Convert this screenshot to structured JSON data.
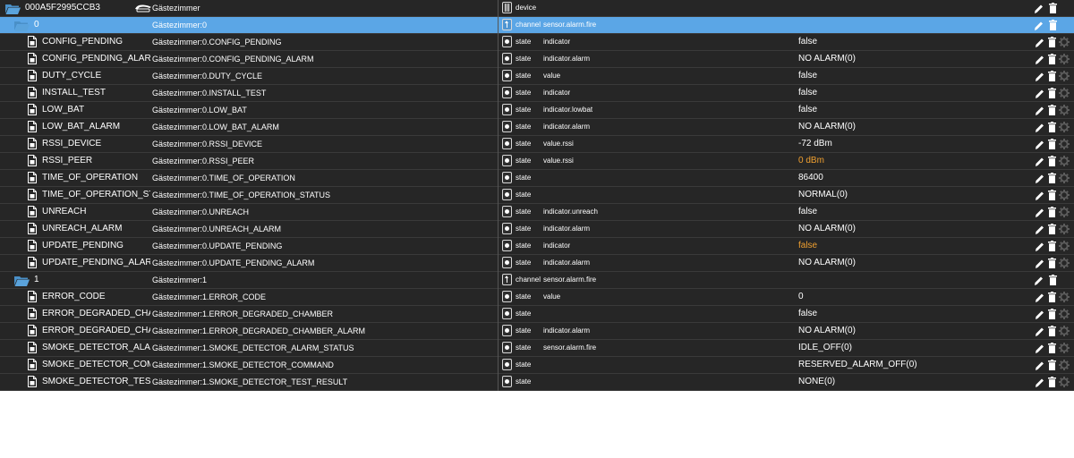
{
  "colors": {
    "row_bg": "#262626",
    "selected_bg": "#5ba6e6",
    "folder": "#4a90c8",
    "text": "#ffffff",
    "warning_value": "#f0a030",
    "icon_muted": "#555555"
  },
  "rows": [
    {
      "kind": "device",
      "level": 0,
      "name": "000A5F2995CCB3",
      "fullname": "Gästezimmer",
      "type": "device",
      "role": "",
      "value": "",
      "room_icon": true
    },
    {
      "kind": "channel",
      "level": 1,
      "name": "0",
      "fullname": "Gästezimmer:0",
      "type": "channel",
      "role": "sensor.alarm.fire",
      "value": "",
      "selected": true
    },
    {
      "kind": "state",
      "level": 2,
      "name": "CONFIG_PENDING",
      "fullname": "Gästezimmer:0.CONFIG_PENDING",
      "type": "state",
      "role": "indicator",
      "value": "false"
    },
    {
      "kind": "state",
      "level": 2,
      "name": "CONFIG_PENDING_ALARM",
      "fullname": "Gästezimmer:0.CONFIG_PENDING_ALARM",
      "type": "state",
      "role": "indicator.alarm",
      "value": "NO ALARM(0)"
    },
    {
      "kind": "state",
      "level": 2,
      "name": "DUTY_CYCLE",
      "fullname": "Gästezimmer:0.DUTY_CYCLE",
      "type": "state",
      "role": "value",
      "value": "false"
    },
    {
      "kind": "state",
      "level": 2,
      "name": "INSTALL_TEST",
      "fullname": "Gästezimmer:0.INSTALL_TEST",
      "type": "state",
      "role": "indicator",
      "value": "false"
    },
    {
      "kind": "state",
      "level": 2,
      "name": "LOW_BAT",
      "fullname": "Gästezimmer:0.LOW_BAT",
      "type": "state",
      "role": "indicator.lowbat",
      "value": "false"
    },
    {
      "kind": "state",
      "level": 2,
      "name": "LOW_BAT_ALARM",
      "fullname": "Gästezimmer:0.LOW_BAT_ALARM",
      "type": "state",
      "role": "indicator.alarm",
      "value": "NO ALARM(0)"
    },
    {
      "kind": "state",
      "level": 2,
      "name": "RSSI_DEVICE",
      "fullname": "Gästezimmer:0.RSSI_DEVICE",
      "type": "state",
      "role": "value.rssi",
      "value": "-72 dBm"
    },
    {
      "kind": "state",
      "level": 2,
      "name": "RSSI_PEER",
      "fullname": "Gästezimmer:0.RSSI_PEER",
      "type": "state",
      "role": "value.rssi",
      "value": "0 dBm",
      "value_warn": true
    },
    {
      "kind": "state",
      "level": 2,
      "name": "TIME_OF_OPERATION",
      "fullname": "Gästezimmer:0.TIME_OF_OPERATION",
      "type": "state",
      "role": "",
      "value": "86400"
    },
    {
      "kind": "state",
      "level": 2,
      "name": "TIME_OF_OPERATION_STATU",
      "fullname": "Gästezimmer:0.TIME_OF_OPERATION_STATUS",
      "type": "state",
      "role": "",
      "value": "NORMAL(0)"
    },
    {
      "kind": "state",
      "level": 2,
      "name": "UNREACH",
      "fullname": "Gästezimmer:0.UNREACH",
      "type": "state",
      "role": "indicator.unreach",
      "value": "false"
    },
    {
      "kind": "state",
      "level": 2,
      "name": "UNREACH_ALARM",
      "fullname": "Gästezimmer:0.UNREACH_ALARM",
      "type": "state",
      "role": "indicator.alarm",
      "value": "NO ALARM(0)"
    },
    {
      "kind": "state",
      "level": 2,
      "name": "UPDATE_PENDING",
      "fullname": "Gästezimmer:0.UPDATE_PENDING",
      "type": "state",
      "role": "indicator",
      "value": "false",
      "value_warn": true
    },
    {
      "kind": "state",
      "level": 2,
      "name": "UPDATE_PENDING_ALARM",
      "fullname": "Gästezimmer:0.UPDATE_PENDING_ALARM",
      "type": "state",
      "role": "indicator.alarm",
      "value": "NO ALARM(0)"
    },
    {
      "kind": "channel",
      "level": 1,
      "name": "1",
      "fullname": "Gästezimmer:1",
      "type": "channel",
      "role": "sensor.alarm.fire",
      "value": ""
    },
    {
      "kind": "state",
      "level": 2,
      "name": "ERROR_CODE",
      "fullname": "Gästezimmer:1.ERROR_CODE",
      "type": "state",
      "role": "value",
      "value": "0"
    },
    {
      "kind": "state",
      "level": 2,
      "name": "ERROR_DEGRADED_CHAMBI",
      "fullname": "Gästezimmer:1.ERROR_DEGRADED_CHAMBER",
      "type": "state",
      "role": "",
      "value": "false"
    },
    {
      "kind": "state",
      "level": 2,
      "name": "ERROR_DEGRADED_CHAMBI",
      "fullname": "Gästezimmer:1.ERROR_DEGRADED_CHAMBER_ALARM",
      "type": "state",
      "role": "indicator.alarm",
      "value": "NO ALARM(0)"
    },
    {
      "kind": "state",
      "level": 2,
      "name": "SMOKE_DETECTOR_ALARM_:",
      "fullname": "Gästezimmer:1.SMOKE_DETECTOR_ALARM_STATUS",
      "type": "state",
      "role": "sensor.alarm.fire",
      "value": "IDLE_OFF(0)"
    },
    {
      "kind": "state",
      "level": 2,
      "name": "SMOKE_DETECTOR_COMMA",
      "fullname": "Gästezimmer:1.SMOKE_DETECTOR_COMMAND",
      "type": "state",
      "role": "",
      "value": "RESERVED_ALARM_OFF(0)"
    },
    {
      "kind": "state",
      "level": 2,
      "name": "SMOKE_DETECTOR_TEST_RES",
      "fullname": "Gästezimmer:1.SMOKE_DETECTOR_TEST_RESULT",
      "type": "state",
      "role": "",
      "value": "NONE(0)"
    }
  ]
}
